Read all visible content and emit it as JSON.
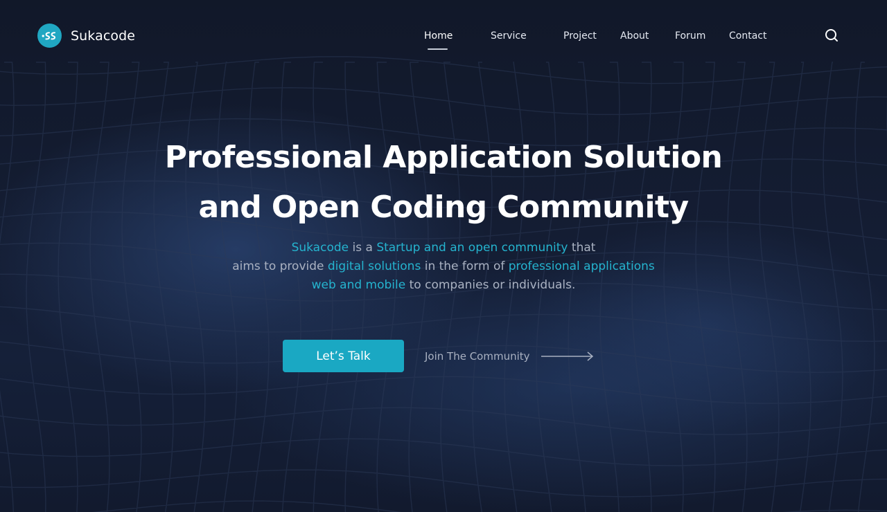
{
  "brand": {
    "name": "Sukacode",
    "logo_glyph": "SS",
    "accent_color": "#1aa8c3"
  },
  "nav": {
    "items": [
      {
        "label": "Home",
        "active": true
      },
      {
        "label": "Service",
        "active": false
      },
      {
        "label": "Project",
        "active": false
      },
      {
        "label": "About",
        "active": false
      },
      {
        "label": "Forum",
        "active": false
      },
      {
        "label": "Contact",
        "active": false
      }
    ],
    "search_icon": "search-icon"
  },
  "hero": {
    "title_line1": "Professional Application Solution",
    "title_line2": "and Open Coding Community",
    "description": {
      "line1": [
        {
          "text": "Sukacode",
          "highlight": true
        },
        {
          "text": " is a ",
          "highlight": false
        },
        {
          "text": "Startup and an open community",
          "highlight": true
        },
        {
          "text": " that",
          "highlight": false
        }
      ],
      "line2": [
        {
          "text": "aims to provide ",
          "highlight": false
        },
        {
          "text": "digital solutions",
          "highlight": true
        },
        {
          "text": " in the form of ",
          "highlight": false
        },
        {
          "text": "professional applications",
          "highlight": true
        }
      ],
      "line3": [
        {
          "text": "web and mobile",
          "highlight": true
        },
        {
          "text": " to companies or individuals.",
          "highlight": false
        }
      ]
    },
    "primary_cta": "Let’s Talk",
    "secondary_cta": "Join The Community",
    "secondary_cta_icon": "arrow-right-icon"
  },
  "colors": {
    "background": "#111829",
    "highlight_text": "#25b4cf",
    "body_text": "#aab2c2"
  }
}
